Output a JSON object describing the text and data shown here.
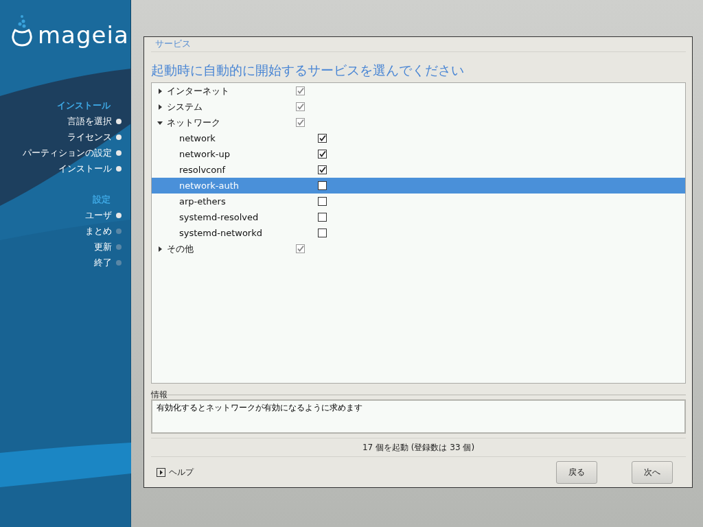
{
  "logo": {
    "text": "mageia"
  },
  "sidebar": {
    "sections": [
      {
        "title": "インストール",
        "steps": [
          {
            "label": "言語を選択",
            "completed": true
          },
          {
            "label": "ライセンス",
            "completed": true
          },
          {
            "label": "パーティションの設定",
            "completed": true
          },
          {
            "label": "インストール",
            "completed": true
          }
        ]
      },
      {
        "title": "設定",
        "steps": [
          {
            "label": "ユーザ",
            "completed": true
          },
          {
            "label": "まとめ",
            "completed": false
          },
          {
            "label": "更新",
            "completed": false
          },
          {
            "label": "終了",
            "completed": false
          }
        ]
      }
    ]
  },
  "dialog": {
    "frame_title": "サービス",
    "heading": "起動時に自動的に開始するサービスを選んでください",
    "tree": [
      {
        "label": "インターネット",
        "kind": "group",
        "expanded": false,
        "checked": true,
        "selected": false
      },
      {
        "label": "システム",
        "kind": "group",
        "expanded": false,
        "checked": true,
        "selected": false
      },
      {
        "label": "ネットワーク",
        "kind": "group",
        "expanded": true,
        "checked": true,
        "selected": false,
        "children": [
          {
            "label": "network",
            "kind": "service",
            "checked": true,
            "selected": false
          },
          {
            "label": "network-up",
            "kind": "service",
            "checked": true,
            "selected": false
          },
          {
            "label": "resolvconf",
            "kind": "service",
            "checked": true,
            "selected": false
          },
          {
            "label": "network-auth",
            "kind": "service",
            "checked": false,
            "selected": true
          },
          {
            "label": "arp-ethers",
            "kind": "service",
            "checked": false,
            "selected": false
          },
          {
            "label": "systemd-resolved",
            "kind": "service",
            "checked": false,
            "selected": false
          },
          {
            "label": "systemd-networkd",
            "kind": "service",
            "checked": false,
            "selected": false
          }
        ]
      },
      {
        "label": "その他",
        "kind": "group",
        "expanded": false,
        "checked": true,
        "selected": false
      }
    ],
    "info": {
      "label": "情報",
      "text": "有効化するとネットワークが有効になるように求めます"
    },
    "status": "17 個を起動 (登録数は 33 個)",
    "help": "ヘルプ",
    "buttons": [
      "戻る",
      "次へ"
    ]
  }
}
